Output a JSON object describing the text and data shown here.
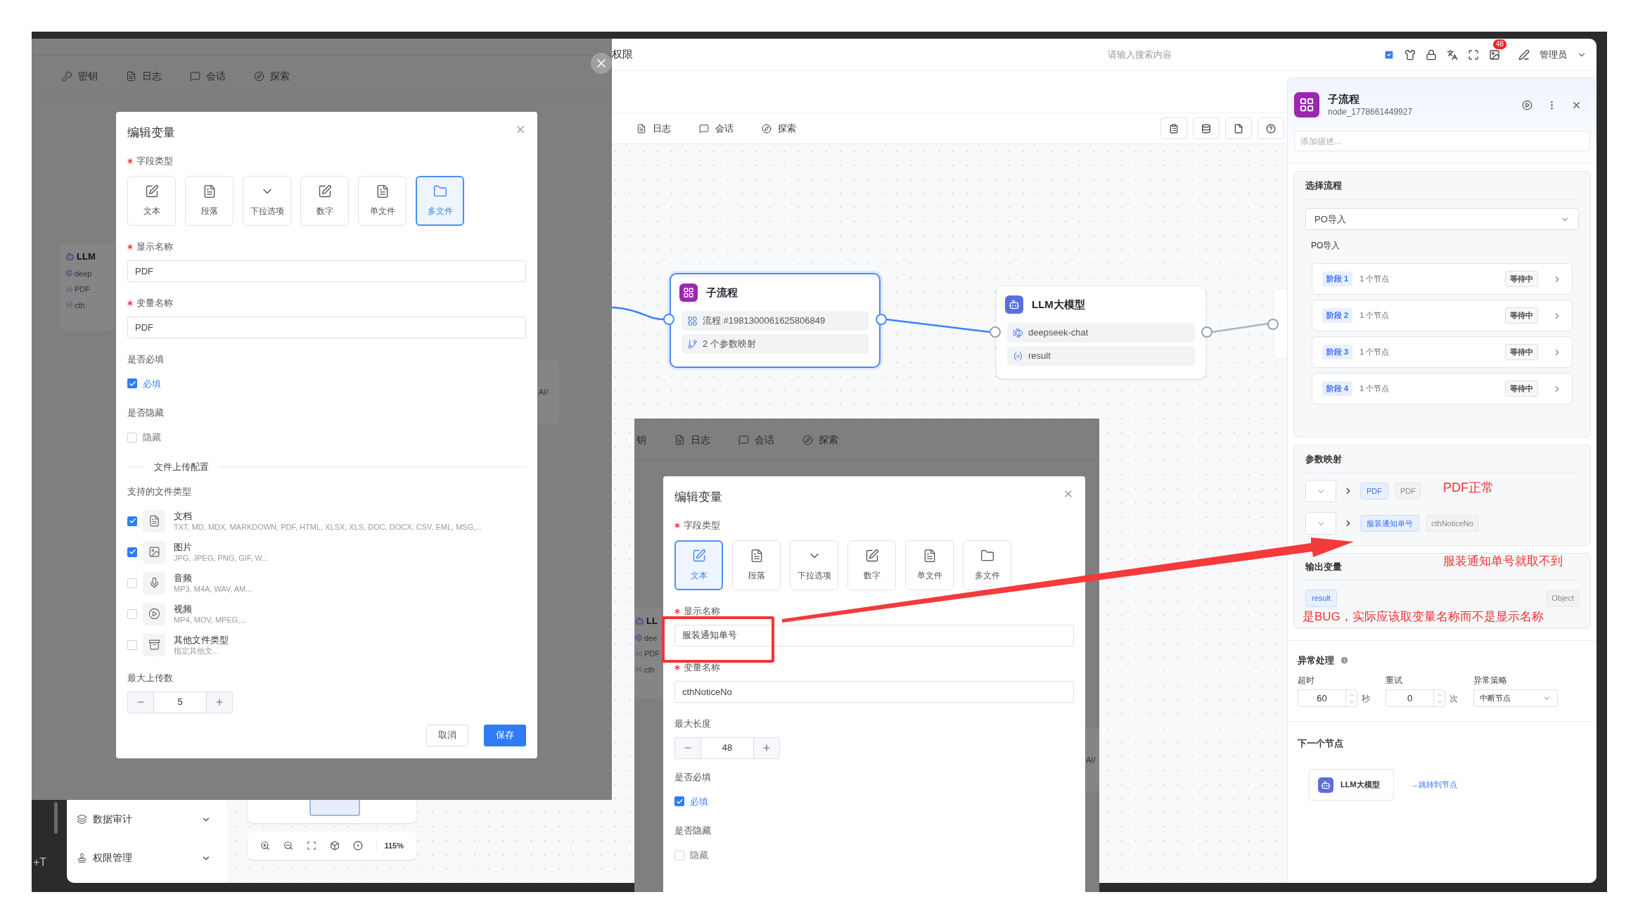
{
  "frame": {
    "side_label": "+T"
  },
  "app": {
    "header": {
      "breadcrumb": "权限",
      "search_placeholder": "请输入搜索内容",
      "notification_count": "48",
      "user": "管理员"
    },
    "tabs": [
      {
        "label": "日志",
        "kind": "log"
      },
      {
        "label": "会话",
        "kind": "chat"
      },
      {
        "label": "探索",
        "kind": "explore"
      }
    ],
    "sidebar": [
      {
        "label": "数据审计",
        "kind": "layers"
      },
      {
        "label": "权限管理",
        "kind": "stamp"
      }
    ],
    "nodes": [
      {
        "kind": "subflow",
        "title": "子流程",
        "selected": true,
        "rows": [
          {
            "kind": "flow",
            "text": "流程 #1981300061625806849"
          },
          {
            "kind": "mapping",
            "text": "2 个参数映射"
          }
        ]
      },
      {
        "kind": "llm",
        "title": "LLM大模型",
        "selected": false,
        "rows": [
          {
            "kind": "model",
            "text": "deepseek-chat"
          },
          {
            "kind": "variable",
            "text": "result"
          }
        ]
      }
    ],
    "zoom": "115%",
    "panel": {
      "title": "子流程",
      "node_id": "node_1778661449927",
      "description_placeholder": "添加描述...",
      "flow": {
        "title": "选择流程",
        "select": "PO导入",
        "name": "PO导入",
        "stages": [
          {
            "label": "阶段 1",
            "count": "1 个节点",
            "status": "等待中"
          },
          {
            "label": "阶段 2",
            "count": "1 个节点",
            "status": "等待中"
          },
          {
            "label": "阶段 3",
            "count": "1 个节点",
            "status": "等待中"
          },
          {
            "label": "阶段 4",
            "count": "1 个节点",
            "status": "等待中"
          }
        ]
      },
      "mapping": {
        "title": "参数映射",
        "rows": [
          {
            "source": "PDF",
            "target": "PDF"
          },
          {
            "source": "服装通知单号",
            "target": "cthNoticeNo"
          }
        ]
      },
      "outputs": {
        "title": "输出变量",
        "items": [
          {
            "name": "result",
            "type": "Object"
          }
        ]
      },
      "error": {
        "title": "异常处理",
        "fields": [
          {
            "kind": "number",
            "label": "超时",
            "value": "60",
            "unit": "秒"
          },
          {
            "kind": "number",
            "label": "重试",
            "value": "0",
            "unit": "次"
          },
          {
            "kind": "select",
            "label": "异常策略",
            "value": "中断节点"
          }
        ]
      },
      "next": {
        "title": "下一个节点",
        "node": "LLM大模型",
        "link": "→跳转到节点"
      }
    }
  },
  "overlays": [
    {
      "close_button": true,
      "tabs": [
        {
          "label": "密钥",
          "kind": "key"
        },
        {
          "label": "日志",
          "kind": "log"
        },
        {
          "label": "会话",
          "kind": "chat"
        },
        {
          "label": "探索",
          "kind": "explore"
        }
      ],
      "fragments": {
        "node_title": "LLM",
        "node_rows": [
          {
            "kind": "model",
            "text": "deep"
          },
          {
            "kind": "variable",
            "text": "PDF"
          },
          {
            "kind": "variable",
            "text": "cth"
          }
        ],
        "edge_label": "AI/"
      },
      "dialog": {
        "title": "编辑变量",
        "fields": [
          {
            "kind": "types",
            "label": "字段类型",
            "required": true,
            "options": [
              {
                "label": "文本",
                "kind": "edit",
                "selected": false
              },
              {
                "label": "段落",
                "kind": "paragraph",
                "selected": false
              },
              {
                "label": "下拉选项",
                "kind": "select",
                "selected": false
              },
              {
                "label": "数字",
                "kind": "number",
                "selected": false
              },
              {
                "label": "单文件",
                "kind": "file",
                "selected": false
              },
              {
                "label": "多文件",
                "kind": "files",
                "selected": true
              }
            ]
          },
          {
            "kind": "input",
            "label": "显示名称",
            "required": true,
            "value": "PDF"
          },
          {
            "kind": "input",
            "label": "变量名称",
            "required": true,
            "value": "PDF"
          },
          {
            "kind": "checkbox",
            "label": "是否必填",
            "option": "必填",
            "checked": true
          },
          {
            "kind": "checkbox",
            "label": "是否隐藏",
            "option": "隐藏",
            "checked": false
          },
          {
            "kind": "divider",
            "label": "文件上传配置"
          },
          {
            "kind": "filetypes",
            "label": "支持的文件类型",
            "items": [
              {
                "kind": "doc",
                "name": "文档",
                "formats": "TXT, MD, MDX, MARKDOWN, PDF, HTML, XLSX, XLS, DOC, DOCX, CSV, EML, MSG,...",
                "checked": true
              },
              {
                "kind": "image",
                "name": "图片",
                "formats": "JPG, JPEG, PNG, GIF, W...",
                "checked": true
              },
              {
                "kind": "audio",
                "name": "音频",
                "formats": "MP3, M4A, WAV, AM...",
                "checked": false
              },
              {
                "kind": "video",
                "name": "视频",
                "formats": "MP4, MOV, MPEG,...",
                "checked": false
              },
              {
                "kind": "other",
                "name": "其他文件类型",
                "formats": "指定其他文...",
                "checked": false
              }
            ]
          },
          {
            "kind": "stepper",
            "label": "最大上传数",
            "value": "5"
          }
        ],
        "buttons": [
          {
            "label": "取消",
            "kind": "default"
          },
          {
            "label": "保存",
            "kind": "primary"
          }
        ]
      }
    },
    {
      "close_button": false,
      "tabs": [
        {
          "label": "钥",
          "kind": "text"
        },
        {
          "label": "日志",
          "kind": "log"
        },
        {
          "label": "会话",
          "kind": "chat"
        },
        {
          "label": "探索",
          "kind": "explore"
        }
      ],
      "fragments": {
        "node_title": "LL",
        "node_rows": [
          {
            "kind": "model",
            "text": "dee"
          },
          {
            "kind": "variable",
            "text": "PDF"
          },
          {
            "kind": "variable",
            "text": "cth"
          }
        ],
        "edge_label": "AI/"
      },
      "dialog": {
        "title": "编辑变量",
        "fields": [
          {
            "kind": "types",
            "label": "字段类型",
            "required": true,
            "options": [
              {
                "label": "文本",
                "kind": "edit",
                "selected": true
              },
              {
                "label": "段落",
                "kind": "paragraph",
                "selected": false
              },
              {
                "label": "下拉选项",
                "kind": "select",
                "selected": false
              },
              {
                "label": "数字",
                "kind": "number",
                "selected": false
              },
              {
                "label": "单文件",
                "kind": "file",
                "selected": false
              },
              {
                "label": "多文件",
                "kind": "files",
                "selected": false
              }
            ]
          },
          {
            "kind": "input",
            "label": "显示名称",
            "required": true,
            "value": "服装通知单号"
          },
          {
            "kind": "input",
            "label": "变量名称",
            "required": true,
            "value": "cthNoticeNo"
          },
          {
            "kind": "stepper",
            "label": "最大长度",
            "value": "48"
          },
          {
            "kind": "checkbox",
            "label": "是否必填",
            "option": "必填",
            "checked": true
          },
          {
            "kind": "checkbox",
            "label": "是否隐藏",
            "option": "隐藏",
            "checked": false
          }
        ]
      }
    }
  ],
  "annotations": {
    "notes": [
      {
        "text": "PDF正常"
      },
      {
        "text": "服装通知单号就取不到"
      },
      {
        "text": "是BUG，实际应该取变量名称而不是显示名称"
      }
    ]
  }
}
